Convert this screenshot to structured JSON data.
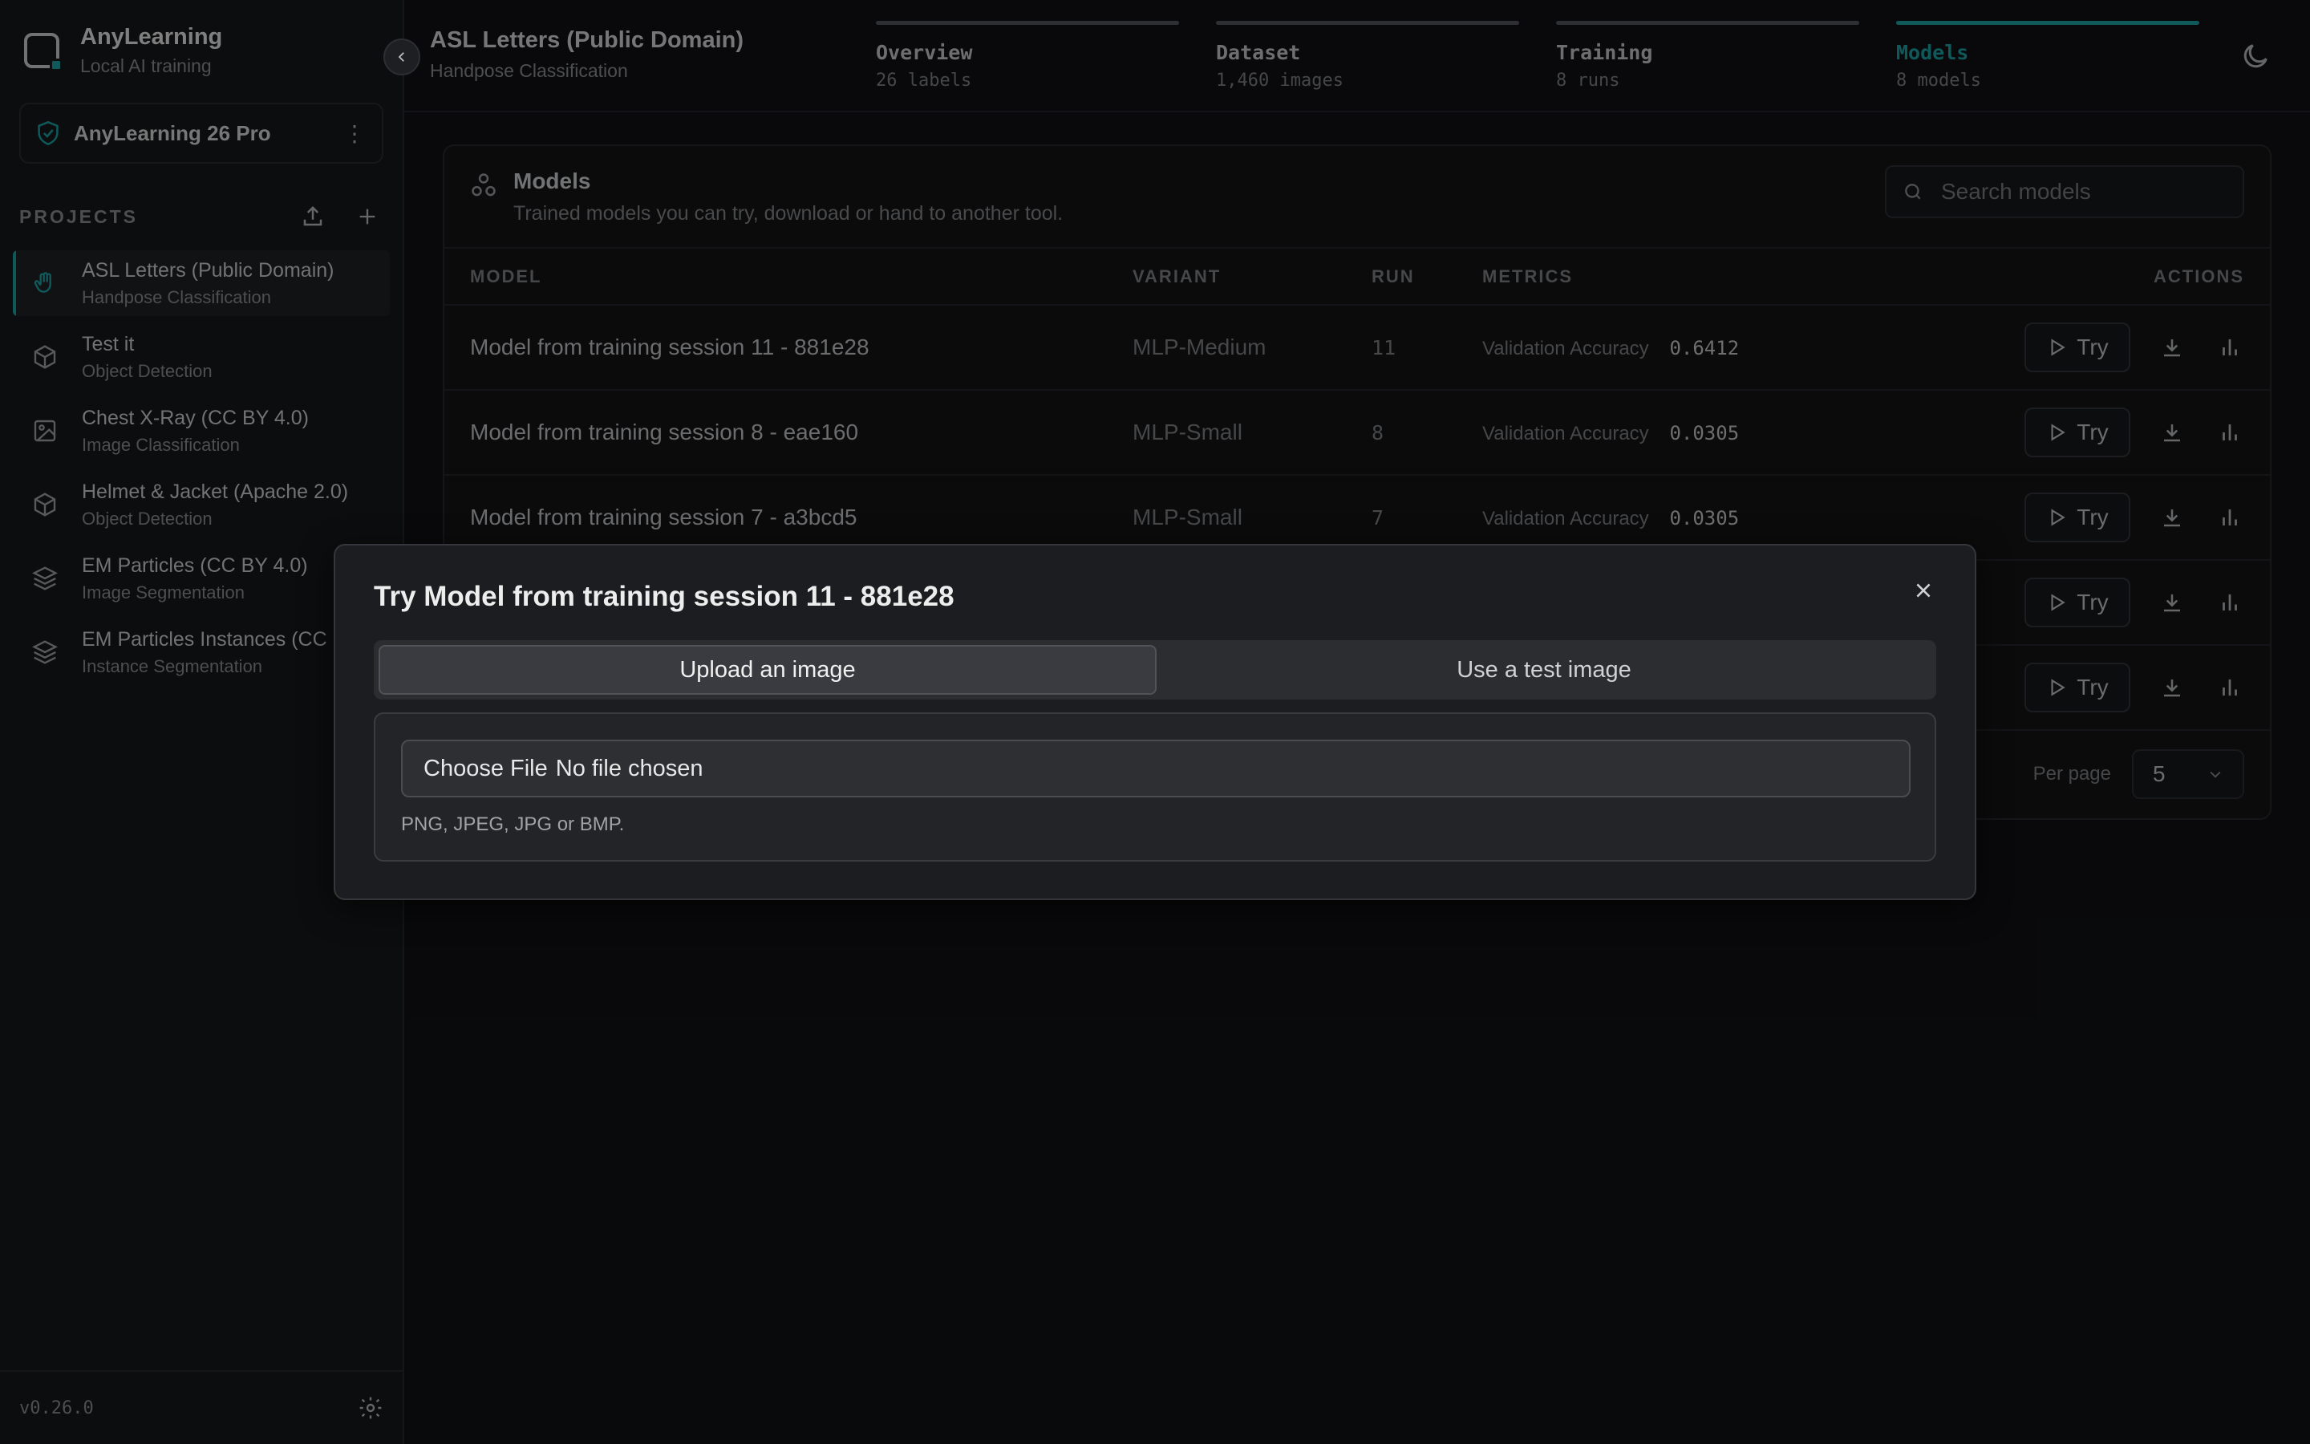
{
  "brand": {
    "name": "AnyLearning",
    "subtitle": "Local AI training"
  },
  "license": {
    "name": "AnyLearning 26 Pro"
  },
  "projects": {
    "header": "PROJECTS",
    "items": [
      {
        "name": "ASL Letters (Public Domain)",
        "type": "Handpose Classification",
        "icon": "hand-icon",
        "active": true
      },
      {
        "name": "Test it",
        "type": "Object Detection",
        "icon": "cube-icon"
      },
      {
        "name": "Chest X-Ray (CC BY 4.0)",
        "type": "Image Classification",
        "icon": "image-icon"
      },
      {
        "name": "Helmet & Jacket (Apache 2.0)",
        "type": "Object Detection",
        "icon": "cube-icon"
      },
      {
        "name": "EM Particles (CC BY 4.0)",
        "type": "Image Segmentation",
        "icon": "layers-icon"
      },
      {
        "name": "EM Particles Instances (CC",
        "type": "Instance Segmentation",
        "icon": "layers-icon"
      }
    ]
  },
  "footer": {
    "version": "v0.26.0"
  },
  "topbar": {
    "project_name": "ASL Letters (Public Domain)",
    "project_type": "Handpose Classification",
    "steps": [
      {
        "label": "Overview",
        "sub": "26 labels"
      },
      {
        "label": "Dataset",
        "sub": "1,460 images"
      },
      {
        "label": "Training",
        "sub": "8 runs"
      },
      {
        "label": "Models",
        "sub": "8 models",
        "active": true
      }
    ]
  },
  "models": {
    "title": "Models",
    "subtitle": "Trained models you can try, download or hand to another tool.",
    "search_placeholder": "Search models",
    "columns": [
      "MODEL",
      "VARIANT",
      "RUN",
      "METRICS",
      "ACTIONS"
    ],
    "rows": [
      {
        "model": "Model from training session 11 - 881e28",
        "variant": "MLP-Medium",
        "run": "11",
        "metric_name": "Validation Accuracy",
        "metric_value": "0.6412"
      },
      {
        "model": "Model from training session 8 - eae160",
        "variant": "MLP-Small",
        "run": "8",
        "metric_name": "Validation Accuracy",
        "metric_value": "0.0305"
      },
      {
        "model": "Model from training session 7 - a3bcd5",
        "variant": "MLP-Small",
        "run": "7",
        "metric_name": "Validation Accuracy",
        "metric_value": "0.0305"
      },
      {
        "model": "",
        "variant": "",
        "run": "",
        "metric_name": "",
        "metric_value": ""
      },
      {
        "model": "",
        "variant": "",
        "run": "",
        "metric_name": "",
        "metric_value": ""
      }
    ],
    "try_label": "Try",
    "per_page_label": "Per page",
    "per_page_value": "5"
  },
  "dialog": {
    "title": "Try Model from training session 11 - 881e28",
    "tabs": [
      "Upload an image",
      "Use a test image"
    ],
    "active_tab": 0,
    "file_button": "Choose File",
    "file_status": "No file chosen",
    "hint": "PNG, JPEG, JPG or BMP."
  },
  "colors": {
    "accent": "#1ca3a6",
    "background": "#111214"
  }
}
